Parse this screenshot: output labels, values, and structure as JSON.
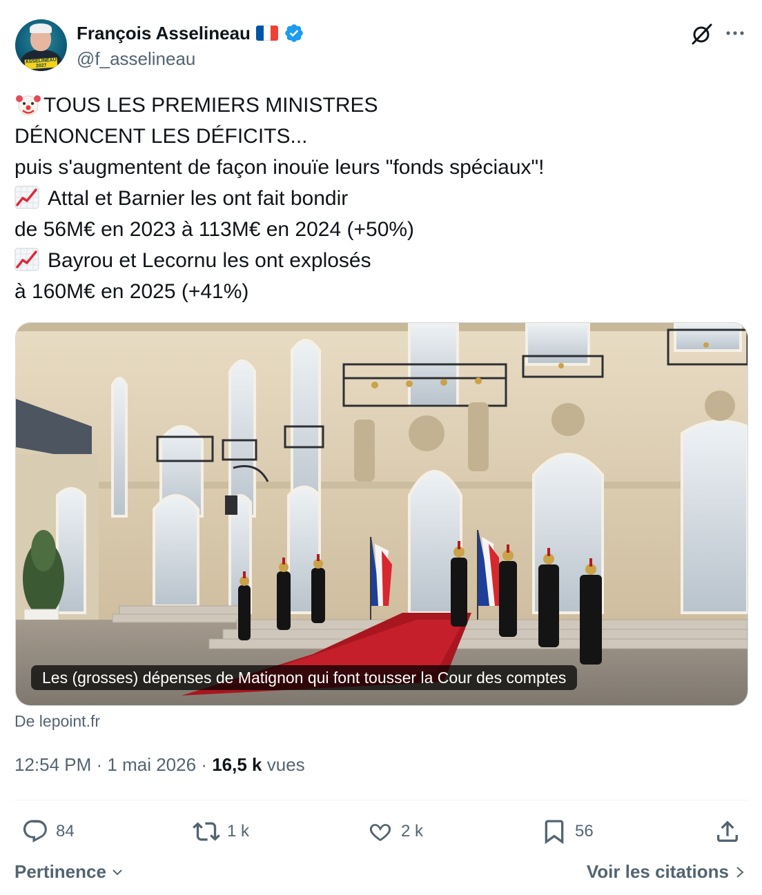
{
  "author": {
    "name": "François Asselineau",
    "handle": "@f_asselineau",
    "avatar_tag": "ASSELINEAU 2027",
    "flag_colors": [
      "#0055A4",
      "#ffffff",
      "#EF4135"
    ],
    "verified_color": "#1d9bf0"
  },
  "header_icons": [
    "grok-icon",
    "more-icon"
  ],
  "tweet": {
    "lines": [
      "TOUS LES PREMIERS MINISTRES",
      "DÉNONCENT LES DÉFICITS...",
      "puis s'augmentent de façon inouïe leurs \"fonds spéciaux\"!",
      "Attal et Barnier les ont fait bondir",
      "de 56M€ en 2023 à 113M€ en 2024 (+50%)",
      "Bayrou et Lecornu les ont explosés",
      "à 160M€ en 2025 (+41%)"
    ]
  },
  "link_card": {
    "caption": "Les (grosses) dépenses de Matignon qui font tousser la Cour des comptes",
    "source": "De lepoint.fr"
  },
  "meta": {
    "time": "12:54 PM",
    "date": "1 mai 2026",
    "views_count": "16,5 k",
    "views_label": "vues"
  },
  "actions": {
    "replies": "84",
    "reposts": "1 k",
    "likes": "2 k",
    "bookmarks": "56"
  },
  "footer": {
    "sort_label": "Pertinence",
    "quotes_link": "Voir les citations"
  },
  "colors": {
    "text": "#0f1419",
    "muted": "#536471",
    "accent": "#1d9bf0"
  }
}
